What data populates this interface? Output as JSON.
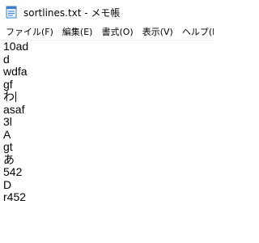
{
  "window": {
    "title": "sortlines.txt - メモ帳",
    "icon": "notepad-icon"
  },
  "menu": {
    "items": [
      {
        "label": "ファイル(F)"
      },
      {
        "label": "編集(E)"
      },
      {
        "label": "書式(O)"
      },
      {
        "label": "表示(V)"
      },
      {
        "label": "ヘルプ(H)"
      }
    ]
  },
  "document": {
    "lines": [
      "10ad",
      "d",
      "wdfa",
      "gf",
      "わ",
      "asaf",
      "3l",
      "A",
      "gt",
      "あ",
      "542",
      "D",
      "r452"
    ],
    "caret_line_index": 4
  },
  "colors": {
    "background": "#ffffff",
    "text": "#000000",
    "icon_blue": "#3c7fd0"
  }
}
